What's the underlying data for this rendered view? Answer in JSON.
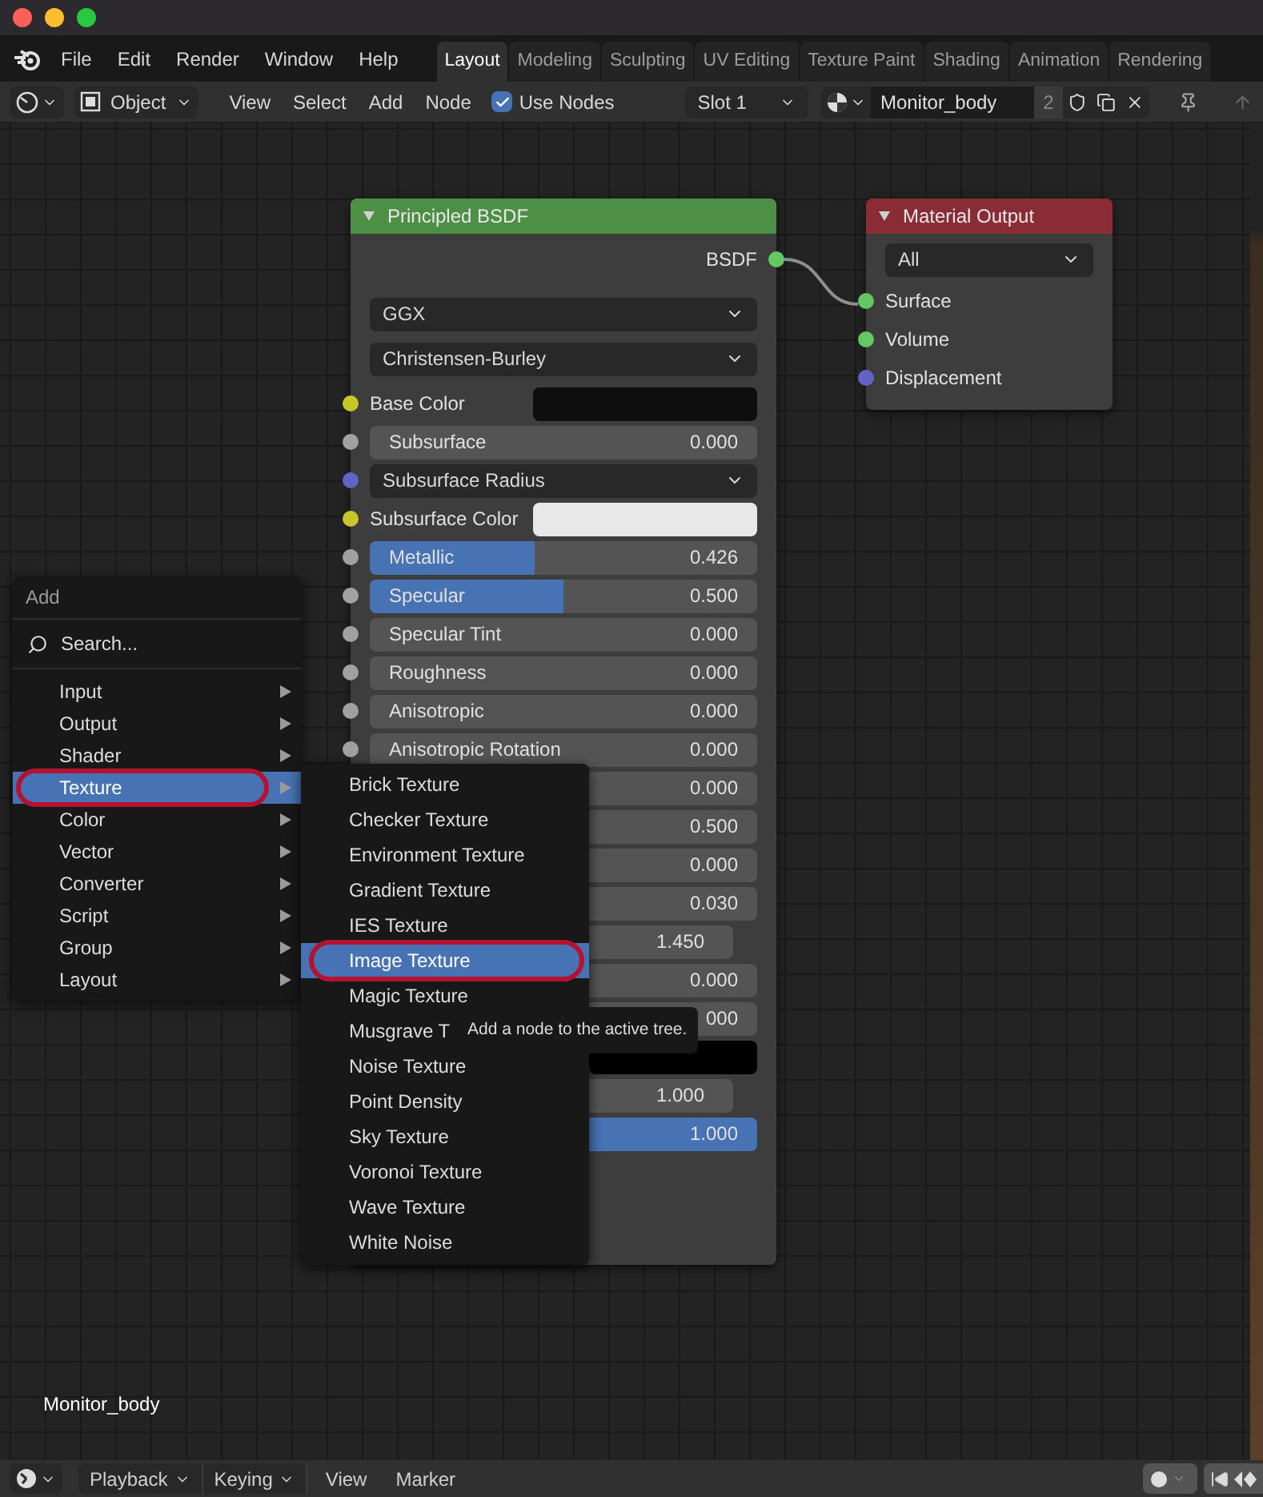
{
  "window": {
    "buttons": [
      {
        "color": "#fe5f57"
      },
      {
        "color": "#febc2e"
      },
      {
        "color": "#28c840"
      }
    ]
  },
  "menubar": [
    "File",
    "Edit",
    "Render",
    "Window",
    "Help"
  ],
  "workspace_tabs": [
    {
      "label": "Layout",
      "selected": true
    },
    {
      "label": "Modeling",
      "selected": false
    },
    {
      "label": "Sculpting",
      "selected": false
    },
    {
      "label": "UV Editing",
      "selected": false
    },
    {
      "label": "Texture Paint",
      "selected": false
    },
    {
      "label": "Shading",
      "selected": false
    },
    {
      "label": "Animation",
      "selected": false
    },
    {
      "label": "Rendering",
      "selected": false
    }
  ],
  "header": {
    "mode": "Object",
    "menus": [
      "View",
      "Select",
      "Add",
      "Node"
    ],
    "use_nodes": {
      "label": "Use Nodes",
      "checked": true
    },
    "slot": "Slot 1",
    "material": "Monitor_body",
    "users": "2"
  },
  "nodes": [
    {
      "title": "Principled BSDF",
      "color": "#4d8f45",
      "kind": "shader",
      "rows": [
        {
          "kind": "output",
          "label": "BSDF",
          "socket": {
            "color": "#63c763"
          }
        },
        {
          "kind": "dropdown",
          "value": "GGX"
        },
        {
          "kind": "dropdown",
          "value": "Christensen-Burley"
        },
        {
          "kind": "color",
          "label": "Base Color",
          "socket": {
            "color": "#c7c729"
          },
          "swatch": {
            "color": "#0e0e0e"
          }
        },
        {
          "kind": "slider",
          "label": "Subsurface",
          "value": "0.000",
          "socket": {
            "color": "#a1a1a1"
          }
        },
        {
          "kind": "dropdown",
          "value": "Subsurface Radius",
          "socket": {
            "color": "#6363c7"
          }
        },
        {
          "kind": "color",
          "label": "Subsurface Color",
          "socket": {
            "color": "#c7c729"
          },
          "swatch": {
            "color": "#e8e8e8"
          }
        },
        {
          "kind": "slider",
          "label": "Metallic",
          "value": "0.426",
          "socket": {
            "color": "#a1a1a1"
          },
          "level": 0.426
        },
        {
          "kind": "slider",
          "label": "Specular",
          "value": "0.500",
          "socket": {
            "color": "#a1a1a1"
          },
          "level": 0.5
        },
        {
          "kind": "slider",
          "label": "Specular Tint",
          "value": "0.000",
          "socket": {
            "color": "#a1a1a1"
          }
        },
        {
          "kind": "slider",
          "label": "Roughness",
          "value": "0.000",
          "socket": {
            "color": "#a1a1a1"
          }
        },
        {
          "kind": "slider",
          "label": "Anisotropic",
          "value": "0.000",
          "socket": {
            "color": "#a1a1a1"
          }
        },
        {
          "kind": "slider",
          "label": "Anisotropic Rotation",
          "value": "0.000",
          "socket": {
            "color": "#a1a1a1"
          }
        },
        {
          "kind": "field",
          "value": "0.000"
        },
        {
          "kind": "field",
          "value": "0.500"
        },
        {
          "kind": "field",
          "value": "0.000"
        },
        {
          "kind": "field",
          "value": "0.030"
        },
        {
          "kind": "number",
          "value": "1.450"
        },
        {
          "kind": "field",
          "value": "0.000"
        },
        {
          "kind": "field",
          "value": "000"
        },
        {
          "kind": "color",
          "swatch": {
            "color": "#000000"
          }
        },
        {
          "kind": "number",
          "value": "1.000"
        },
        {
          "kind": "slider",
          "value": "1.000",
          "level": 1
        }
      ]
    },
    {
      "title": "Material Output",
      "color": "#8a2c36",
      "kind": "output",
      "rows": [
        {
          "kind": "dropdown",
          "value": "All"
        },
        {
          "kind": "input",
          "label": "Surface",
          "socket": {
            "color": "#63c763"
          }
        },
        {
          "kind": "input",
          "label": "Volume",
          "socket": {
            "color": "#63c763"
          }
        },
        {
          "kind": "input",
          "label": "Displacement",
          "socket": {
            "color": "#6363c7"
          }
        }
      ]
    }
  ],
  "add_menu": {
    "title": "Add",
    "search": "Search...",
    "items": [
      {
        "label": "Input",
        "selected": false,
        "circled": false
      },
      {
        "label": "Output",
        "selected": false,
        "circled": false
      },
      {
        "label": "Shader",
        "selected": false,
        "circled": false
      },
      {
        "label": "Texture",
        "selected": true,
        "circled": true
      },
      {
        "label": "Color",
        "selected": false,
        "circled": false
      },
      {
        "label": "Vector",
        "selected": false,
        "circled": false
      },
      {
        "label": "Converter",
        "selected": false,
        "circled": false
      },
      {
        "label": "Script",
        "selected": false,
        "circled": false
      },
      {
        "label": "Group",
        "selected": false,
        "circled": false
      },
      {
        "label": "Layout",
        "selected": false,
        "circled": false
      }
    ]
  },
  "texture_menu": {
    "items": [
      {
        "label": "Brick Texture",
        "selected": false,
        "circled": false
      },
      {
        "label": "Checker Texture",
        "selected": false,
        "circled": false
      },
      {
        "label": "Environment Texture",
        "selected": false,
        "circled": false
      },
      {
        "label": "Gradient Texture",
        "selected": false,
        "circled": false
      },
      {
        "label": "IES Texture",
        "selected": false,
        "circled": false
      },
      {
        "label": "Image Texture",
        "selected": true,
        "circled": true
      },
      {
        "label": "Magic Texture",
        "selected": false,
        "circled": false
      },
      {
        "label": "Musgrave T",
        "selected": false,
        "circled": false
      },
      {
        "label": "Noise Texture",
        "selected": false,
        "circled": false
      },
      {
        "label": "Point Density",
        "selected": false,
        "circled": false
      },
      {
        "label": "Sky Texture",
        "selected": false,
        "circled": false
      },
      {
        "label": "Voronoi Texture",
        "selected": false,
        "circled": false
      },
      {
        "label": "Wave Texture",
        "selected": false,
        "circled": false
      },
      {
        "label": "White Noise",
        "selected": false,
        "circled": false
      }
    ]
  },
  "tooltip": "Add a node to the active tree.",
  "object_label": "Monitor_body",
  "timeline": {
    "dropdowns": [
      "Playback",
      "Keying"
    ],
    "menus": [
      "View",
      "Marker"
    ]
  }
}
